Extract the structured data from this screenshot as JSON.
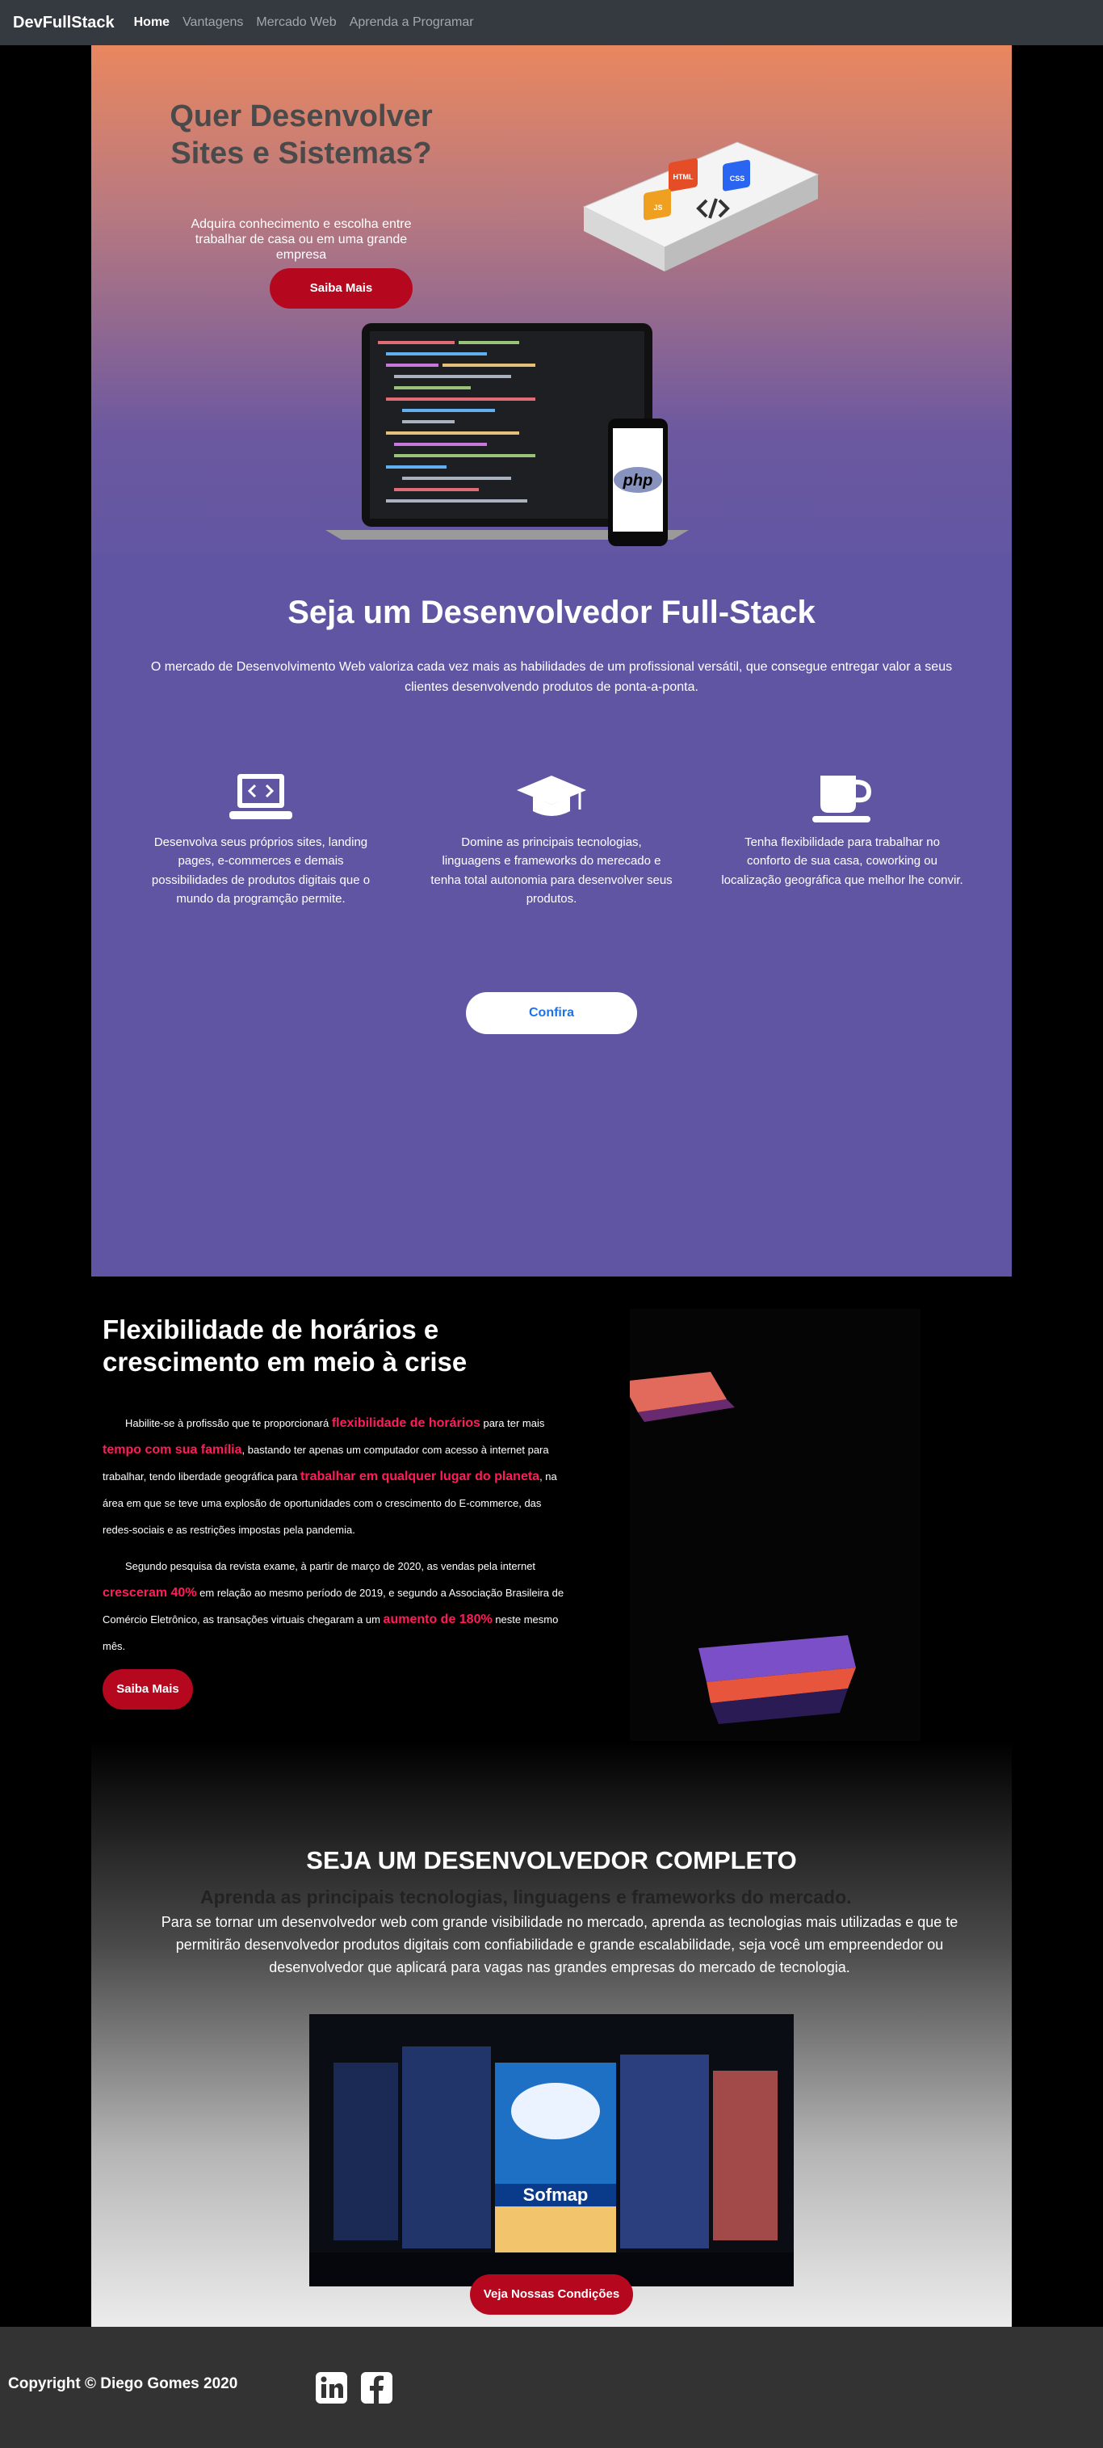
{
  "navbar": {
    "brand": "DevFullStack",
    "links": [
      "Home",
      "Vantagens",
      "Mercado Web",
      "Aprenda a Programar"
    ]
  },
  "hero": {
    "title": "Quer Desenvolver Sites e Sistemas?",
    "subtitle": "Adquira conhecimento e escolha entre trabalhar de casa ou em uma grande empresa",
    "button": "Saiba Mais",
    "book_labels": {
      "html": "HTML",
      "css": "CSS",
      "js": "JS"
    },
    "phone_label": "php"
  },
  "fullstack": {
    "title": "Seja um Desenvolvedor Full-Stack",
    "description": "O mercado de Desenvolvimento Web valoriza cada vez mais as habilidades de um profissional versátil, que consegue entregar valor a seus clientes desenvolvendo produtos de ponta-a-ponta.",
    "features": [
      {
        "icon": "laptop-code-icon",
        "text": "Desenvolva seus próprios sites, landing pages, e-commerces e demais possibilidades de produtos digitais que o mundo da programção permite."
      },
      {
        "icon": "graduation-cap-icon",
        "text": "Domine as principais tecnologias, linguagens e frameworks do merecado e tenha total autonomia para desenvolver seus produtos."
      },
      {
        "icon": "coffee-cup-icon",
        "text": "Tenha flexibilidade para trabalhar no conforto de sua casa, coworking ou localização geográfica que melhor lhe convir."
      }
    ],
    "button": "Confira"
  },
  "flexibility": {
    "title": "Flexibilidade de horários e crescimento em meio à crise",
    "p1": {
      "t1": "Habilite-se à profissão que te proporcionará ",
      "h1": "flexibilidade de horários",
      "t2": " para ter mais ",
      "h2": "tempo com sua família",
      "t3": ", bastando ter apenas um computador com acesso à internet para trabalhar, tendo liberdade geográfica para ",
      "h3": "trabalhar em qualquer lugar do planeta",
      "t4": ", na área em que se teve uma explosão de oportunidades com o crescimento do E-commerce, das redes-sociais e as restrições impostas pela pandemia."
    },
    "p2": {
      "t1": "Segundo pesquisa da revista exame, à partir de março de 2020, as vendas pela internet ",
      "h1": "cresceram 40%",
      "t2": " em relação ao mesmo período de 2019, e segundo a Associação Brasileira de Comércio Eletrônico, as transações virtuais chegaram a um ",
      "h2": "aumento de 180%",
      "t3": " neste mesmo mês."
    },
    "button": "Saiba Mais"
  },
  "complete": {
    "title": "SEJA UM DESENVOLVEDOR COMPLETO",
    "subtitle": "Aprenda as principais tecnologias, linguagens e frameworks do mercado.",
    "description": "Para se tornar um desenvolvedor web com grande visibilidade no mercado, aprenda as tecnologias mais utilizadas e que te permitirão desenvolvedor produtos digitais com confiabilidade e grande escalabilidade, seja você um empreendedor ou desenvolvedor que aplicará para vagas nas grandes empresas do mercado de tecnologia.",
    "store_sign": "Sofmap",
    "button": "Veja Nossas Condições"
  },
  "footer": {
    "copyright": "Copyright © Diego Gomes 2020",
    "social": [
      "linkedin-icon",
      "facebook-icon"
    ]
  },
  "colors": {
    "accent_red": "#b5081e",
    "highlight_pink": "#ff1d59",
    "purple": "#5f55a3",
    "navbar": "#343a40"
  }
}
